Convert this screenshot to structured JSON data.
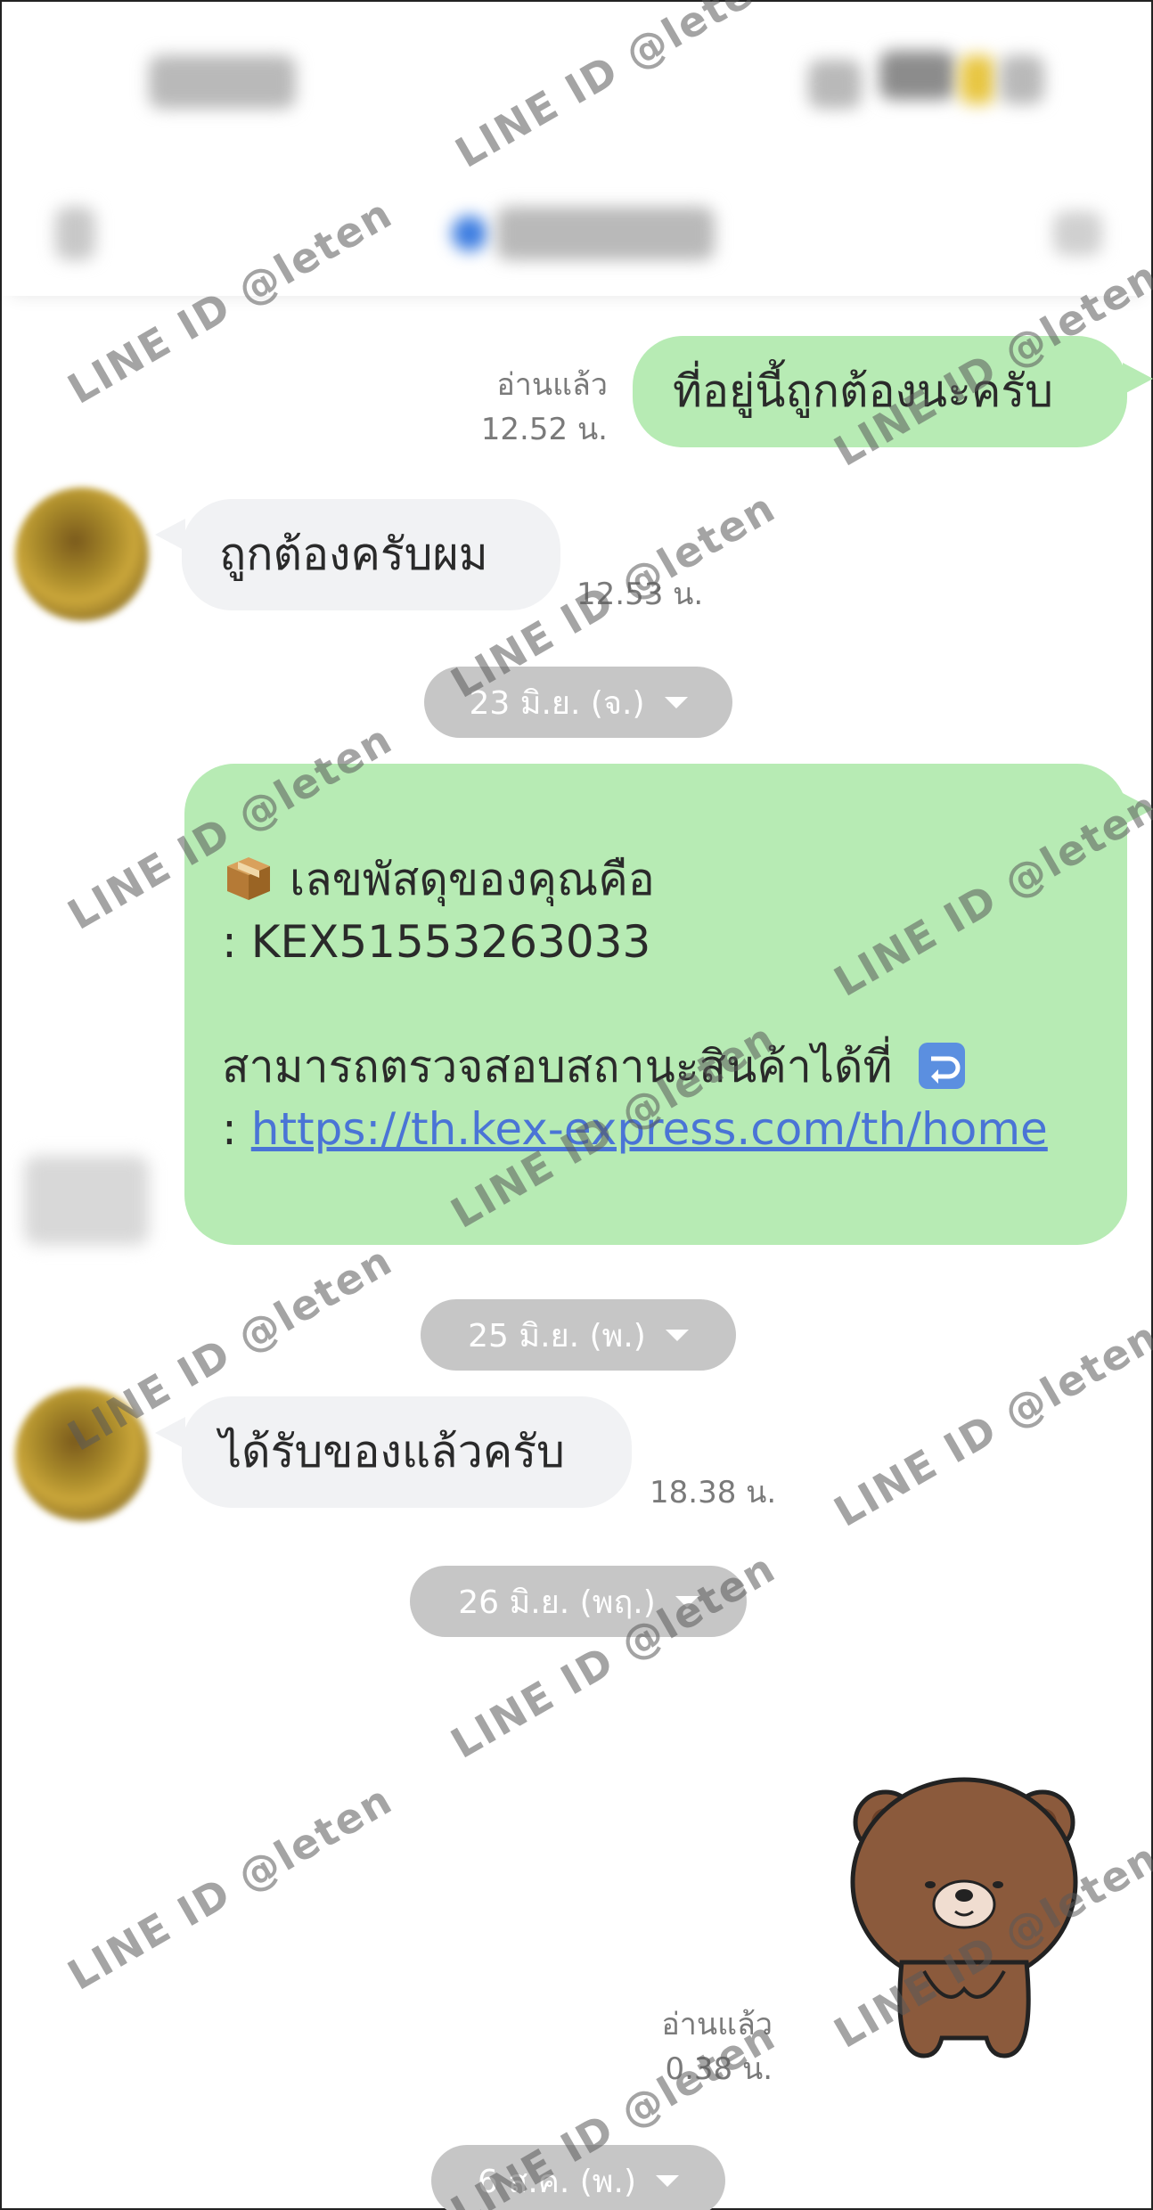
{
  "messages": {
    "m1": {
      "text": "ที่อยู่นี้ถูกต้องนะครับ",
      "read": "อ่านแล้ว",
      "time": "12.52 น."
    },
    "m2": {
      "text": "ถูกต้องครับผม",
      "time": "12.53 น."
    },
    "date1": "23 มิ.ย. (จ.)",
    "m3": {
      "line1": "เลขพัสดุของคุณคือ",
      "line2": ": KEX51553263033",
      "line3": "สามารถตรวจสอบสถานะสินค้าได้ที่",
      "link_prefix": ": ",
      "link": "https://th.kex-express.com/th/home"
    },
    "date2": "25 มิ.ย. (พ.)",
    "m4": {
      "text": "ได้รับของแล้วครับ",
      "time": "18.38 น."
    },
    "date3": "26 มิ.ย. (พฤ.)",
    "m5": {
      "sticker": "brown-bear-sticker",
      "read": "อ่านแล้ว",
      "time": "0.38 น."
    },
    "date4": "6 ส.ค. (พ.)"
  },
  "watermark": "LINE ID @leten",
  "colors": {
    "outgoing_bubble": "#b7ebb4",
    "incoming_bubble": "#f1f2f4",
    "date_pill": "#c6c6c6",
    "link": "#4a74d6"
  }
}
